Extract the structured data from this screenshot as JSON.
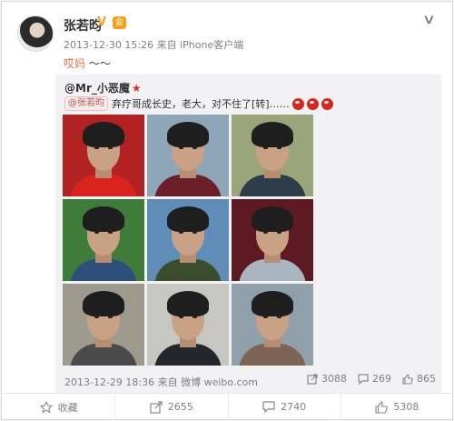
{
  "post": {
    "user_name": "张若昀",
    "member_label": "会",
    "meta": "2013-12-30 15:26 来自 iPhone客户端",
    "text_red": "哎妈",
    "text_rest": "～～",
    "collapse_icon": "chevron-down-icon"
  },
  "repost": {
    "user": "@Mr_小恶魔",
    "mention": "@张若昀",
    "text": "弃疗哥成长史，老大，对不住了[转]……",
    "meta": "2013-12-29 18:36 来自 微博 weibo.com",
    "stats": {
      "forward": "3088",
      "comment": "269",
      "like": "865"
    },
    "photos": [
      {
        "bg": "#b22222",
        "shirt": "#d8241c"
      },
      {
        "bg": "#8fa6b8",
        "shirt": "#6a1f2a"
      },
      {
        "bg": "#9aa57a",
        "shirt": "#2d3e4a"
      },
      {
        "bg": "#3f7c3a",
        "shirt": "#2d4f7a"
      },
      {
        "bg": "#5f8db8",
        "shirt": "#3a4d2c"
      },
      {
        "bg": "#5d1a22",
        "shirt": "#a9b6c2"
      },
      {
        "bg": "#9e9a8e",
        "shirt": "#4a4a4a"
      },
      {
        "bg": "#c7c7c1",
        "shirt": "#23262b"
      },
      {
        "bg": "#8fa0ab",
        "shirt": "#7d6354"
      }
    ]
  },
  "actions": {
    "favorite": "收藏",
    "forward": "2655",
    "comment": "2740",
    "like": "5308"
  }
}
